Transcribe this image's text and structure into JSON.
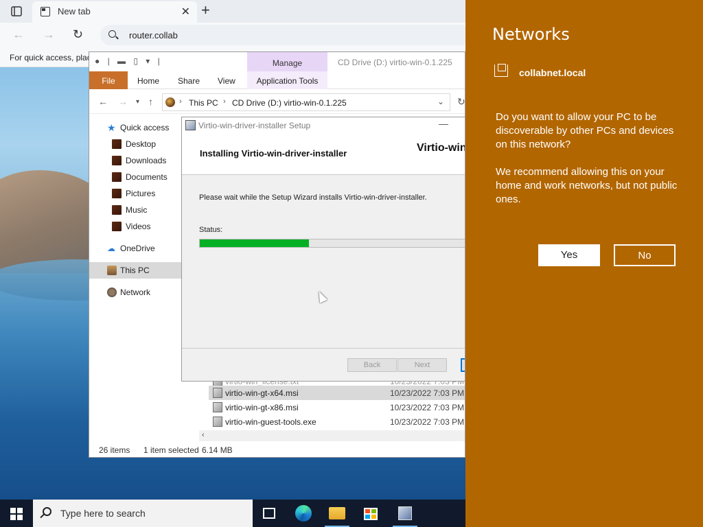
{
  "browser": {
    "tab_title": "New tab",
    "new_tab_symbol": "+",
    "address": "router.collab",
    "quick_access_text": "For quick access, plac"
  },
  "explorer": {
    "window_title": "CD Drive (D:) virtio-win-0.1.225",
    "context_tab": "Manage",
    "ribbon_tabs": {
      "file": "File",
      "home": "Home",
      "share": "Share",
      "view": "View",
      "app_tools": "Application Tools"
    },
    "breadcrumb": [
      "This PC",
      "CD Drive (D:) virtio-win-0.1.225"
    ],
    "nav": {
      "quick_access": "Quick access",
      "desktop": "Desktop",
      "downloads": "Downloads",
      "documents": "Documents",
      "pictures": "Pictures",
      "music": "Music",
      "videos": "Videos",
      "onedrive": "OneDrive",
      "this_pc": "This PC",
      "network": "Network"
    },
    "files": [
      {
        "name": "virtio-win_license.txt",
        "date": "10/23/2022 7:03 PM"
      },
      {
        "name": "virtio-win-gt-x64.msi",
        "date": "10/23/2022 7:03 PM"
      },
      {
        "name": "virtio-win-gt-x86.msi",
        "date": "10/23/2022 7:03 PM"
      },
      {
        "name": "virtio-win-guest-tools.exe",
        "date": "10/23/2022 7:03 PM"
      }
    ],
    "status": {
      "items": "26 items",
      "selected": "1 item selected",
      "size": "6.14 MB"
    }
  },
  "setup": {
    "title": "Virtio-win-driver-installer Setup",
    "heading": "Installing Virtio-win-driver-installer",
    "brand": "Virtio-win",
    "message": "Please wait while the Setup Wizard installs Virtio-win-driver-installer.",
    "status_label": "Status:",
    "progress_fraction": 0.4,
    "back_label": "Back",
    "next_label": "Next"
  },
  "networks": {
    "title": "Networks",
    "network_name": "collabnet.local",
    "question": "Do you want to allow your PC to be discoverable by other PCs and devices on this network?",
    "recommendation": "We recommend allowing this on your home and work networks, but not public ones.",
    "yes_label": "Yes",
    "no_label": "No",
    "background_color": "#b26600"
  },
  "taskbar": {
    "search_placeholder": "Type here to search",
    "icons": [
      "task-view-icon",
      "edge-icon",
      "file-explorer-icon",
      "store-icon",
      "installer-icon"
    ]
  }
}
